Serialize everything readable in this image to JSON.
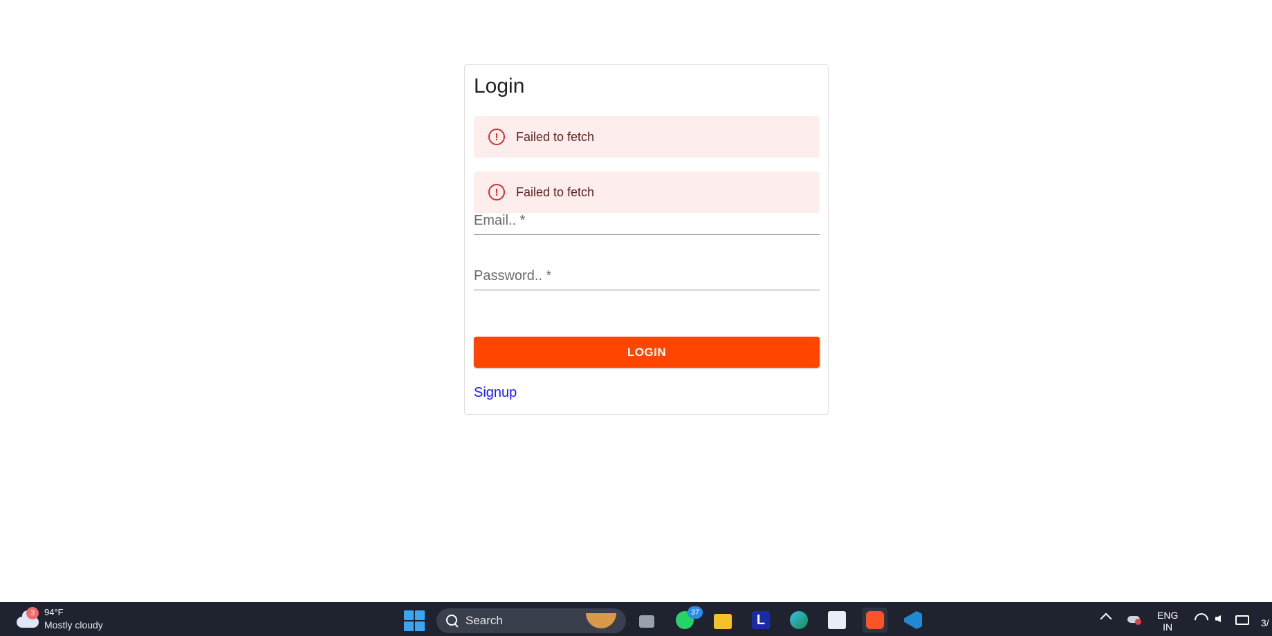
{
  "login_card": {
    "title": "Login",
    "alerts": [
      {
        "icon": "error-outline-icon",
        "message": "Failed to fetch"
      },
      {
        "icon": "error-outline-icon",
        "message": "Failed to fetch"
      }
    ],
    "email_label": "Email.. *",
    "password_label": "Password.. *",
    "login_button": "LOGIN",
    "signup_link": "Signup",
    "colors": {
      "primary": "#ff4500",
      "alert_bg": "#fdeded",
      "alert_icon": "#d32f2f",
      "link": "#1a1aff"
    }
  },
  "taskbar": {
    "weather": {
      "badge": "3",
      "temperature": "94°F",
      "description": "Mostly cloudy"
    },
    "search_placeholder": "Search",
    "apps": [
      {
        "name": "task-view",
        "icon": "task-view-icon"
      },
      {
        "name": "whatsapp",
        "icon": "whatsapp-icon",
        "badge": "37"
      },
      {
        "name": "file-explorer",
        "icon": "folder-icon"
      },
      {
        "name": "l-app",
        "icon": "l-app-icon",
        "label": "L"
      },
      {
        "name": "edge",
        "icon": "edge-icon"
      },
      {
        "name": "store",
        "icon": "store-icon"
      },
      {
        "name": "brave",
        "icon": "brave-icon"
      },
      {
        "name": "vscode",
        "icon": "vscode-icon"
      }
    ],
    "language": {
      "line1": "ENG",
      "line2": "IN"
    },
    "clock_partial": "3/"
  }
}
